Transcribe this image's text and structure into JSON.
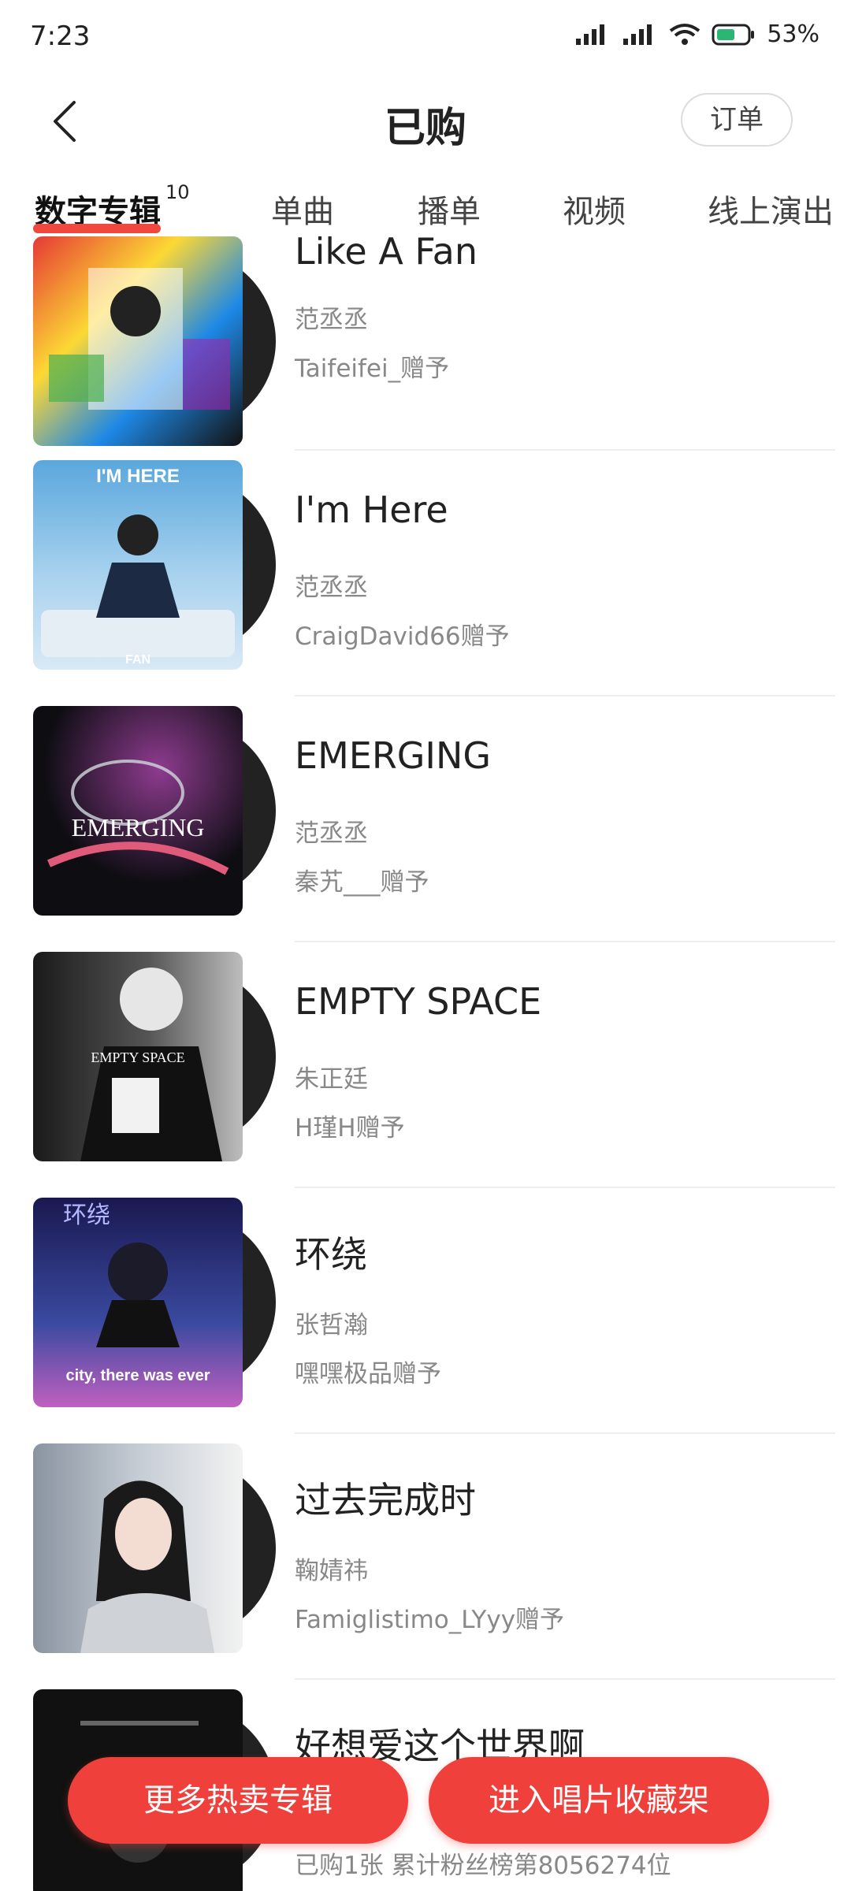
{
  "status_bar": {
    "time": "7:23",
    "battery": "53%"
  },
  "header": {
    "title": "已购",
    "order_label": "订单"
  },
  "tabs": [
    {
      "label": "数字专辑",
      "badge": "10",
      "active": true
    },
    {
      "label": "单曲"
    },
    {
      "label": "播单"
    },
    {
      "label": "视频"
    },
    {
      "label": "线上演出"
    }
  ],
  "albums": [
    {
      "title": "Like A Fan",
      "artist": "范丞丞",
      "gift": "Taifeifei_赠予",
      "cover_colors": [
        "#e53935",
        "#1e88e5",
        "#fdd835"
      ]
    },
    {
      "title": "I'm Here",
      "artist": "范丞丞",
      "gift": "CraigDavid66赠予",
      "cover_colors": [
        "#5aa7dd",
        "#1c2a44",
        "#d9e9f5"
      ],
      "cover_text_top": "I'M HERE",
      "cover_text_bottom": "FAN"
    },
    {
      "title": "EMERGING",
      "artist": "范丞丞",
      "gift": "秦艽___赠予",
      "cover_colors": [
        "#0d0d12",
        "#8e3b8f",
        "#e05a7a"
      ],
      "cover_text_top": "EMERGING"
    },
    {
      "title": "EMPTY SPACE",
      "artist": "朱正廷",
      "gift": "H瑾H赠予",
      "cover_colors": [
        "#1a1a1a",
        "#bdbdbd",
        "#eeeeee"
      ],
      "cover_text_top": "EMPTY SPACE"
    },
    {
      "title": "环绕",
      "artist": "张哲瀚",
      "gift": "嘿嘿极品赠予",
      "cover_colors": [
        "#1a1850",
        "#3a4aa0",
        "#c060c0"
      ],
      "cover_text_top": "环绕",
      "cover_text_bottom": "city, there was ever"
    },
    {
      "title": "过去完成时",
      "artist": "鞠婧祎",
      "gift": "Famiglistimo_LYyy赠予",
      "cover_colors": [
        "#8a94a0",
        "#f2f2f2",
        "#1a1a1a"
      ]
    },
    {
      "title": "好想爱这个世界啊",
      "artist": "",
      "gift": "已购1张 累计粉丝榜第8056274位",
      "cover_colors": [
        "#111111",
        "#333333",
        "#555555"
      ]
    }
  ],
  "bottom_buttons": {
    "more_label": "更多热卖专辑",
    "shelf_label": "进入唱片收藏架"
  },
  "colors": {
    "accent": "#f0403c",
    "text": "#222222",
    "secondary": "#888888"
  }
}
